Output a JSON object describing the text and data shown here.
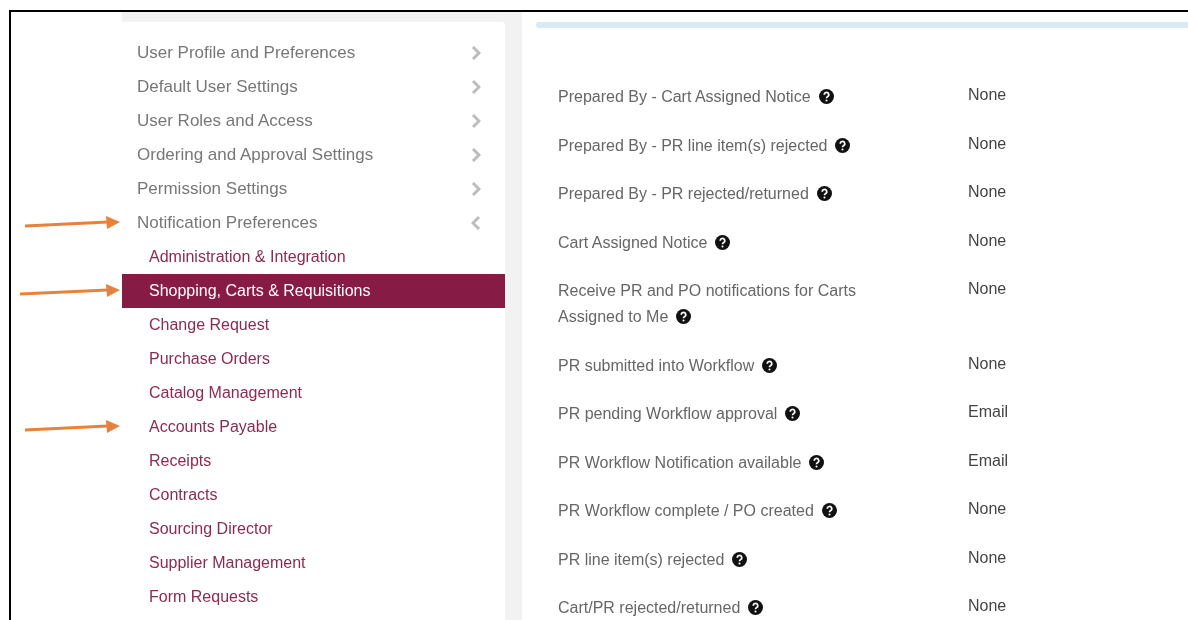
{
  "sidebar": {
    "items": [
      {
        "label": "User Profile and Preferences",
        "expanded": false,
        "arrow": false
      },
      {
        "label": "Default User Settings",
        "expanded": false,
        "arrow": false
      },
      {
        "label": "User Roles and Access",
        "expanded": false,
        "arrow": false
      },
      {
        "label": "Ordering and Approval Settings",
        "expanded": false,
        "arrow": false
      },
      {
        "label": "Permission Settings",
        "expanded": false,
        "arrow": false
      },
      {
        "label": "Notification Preferences",
        "expanded": true,
        "arrow": true,
        "children": [
          {
            "label": "Administration & Integration",
            "selected": false,
            "arrow": false
          },
          {
            "label": "Shopping, Carts & Requisitions",
            "selected": true,
            "arrow": true
          },
          {
            "label": "Change Request",
            "selected": false,
            "arrow": false
          },
          {
            "label": "Purchase Orders",
            "selected": false,
            "arrow": false
          },
          {
            "label": "Catalog Management",
            "selected": false,
            "arrow": false
          },
          {
            "label": "Accounts Payable",
            "selected": false,
            "arrow": true
          },
          {
            "label": "Receipts",
            "selected": false,
            "arrow": false
          },
          {
            "label": "Contracts",
            "selected": false,
            "arrow": false
          },
          {
            "label": "Sourcing Director",
            "selected": false,
            "arrow": false
          },
          {
            "label": "Supplier Management",
            "selected": false,
            "arrow": false
          },
          {
            "label": "Form Requests",
            "selected": false,
            "arrow": false
          }
        ]
      }
    ]
  },
  "notifications": [
    {
      "label": "Prepared By - Cart Assigned Notice",
      "value": "None"
    },
    {
      "label": "Prepared By - PR line item(s) rejected",
      "value": "None"
    },
    {
      "label": "Prepared By - PR rejected/returned",
      "value": "None"
    },
    {
      "label": "Cart Assigned Notice",
      "value": "None"
    },
    {
      "label": "Receive PR and PO notifications for Carts Assigned to Me",
      "value": "None"
    },
    {
      "label": "PR submitted into Workflow",
      "value": "None"
    },
    {
      "label": "PR pending Workflow approval",
      "value": "Email"
    },
    {
      "label": "PR Workflow Notification available",
      "value": "Email"
    },
    {
      "label": "PR Workflow complete / PO created",
      "value": "None"
    },
    {
      "label": "PR line item(s) rejected",
      "value": "None"
    },
    {
      "label": "Cart/PR rejected/returned",
      "value": "None"
    }
  ]
}
